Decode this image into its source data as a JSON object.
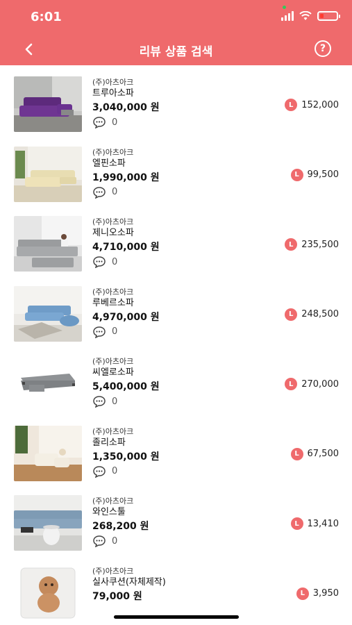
{
  "status": {
    "time": "6:01"
  },
  "nav": {
    "title": "리뷰 상품 검색",
    "back_icon": "chevron-left-icon",
    "help_label": "?"
  },
  "colors": {
    "accent": "#ef6a6c"
  },
  "products": [
    {
      "brand": "(주)아츠아크",
      "name": "트루아소파",
      "price": "3,040,000 원",
      "reviews": "0",
      "points": "152,000"
    },
    {
      "brand": "(주)아츠아크",
      "name": "엘핀소파",
      "price": "1,990,000 원",
      "reviews": "0",
      "points": "99,500"
    },
    {
      "brand": "(주)아츠아크",
      "name": "제니오소파",
      "price": "4,710,000 원",
      "reviews": "0",
      "points": "235,500"
    },
    {
      "brand": "(주)아츠아크",
      "name": "루베르소파",
      "price": "4,970,000 원",
      "reviews": "0",
      "points": "248,500"
    },
    {
      "brand": "(주)아츠아크",
      "name": "씨엘로소파",
      "price": "5,400,000 원",
      "reviews": "0",
      "points": "270,000"
    },
    {
      "brand": "(주)아츠아크",
      "name": "졸리소파",
      "price": "1,350,000 원",
      "reviews": "0",
      "points": "67,500"
    },
    {
      "brand": "(주)아츠아크",
      "name": "와인스툴",
      "price": "268,200 원",
      "reviews": "0",
      "points": "13,410"
    },
    {
      "brand": "(주)아츠아크",
      "name": "실사쿠션(자체제작)",
      "price": "79,000 원",
      "reviews": "",
      "points": "3,950"
    }
  ],
  "points_badge": "L"
}
